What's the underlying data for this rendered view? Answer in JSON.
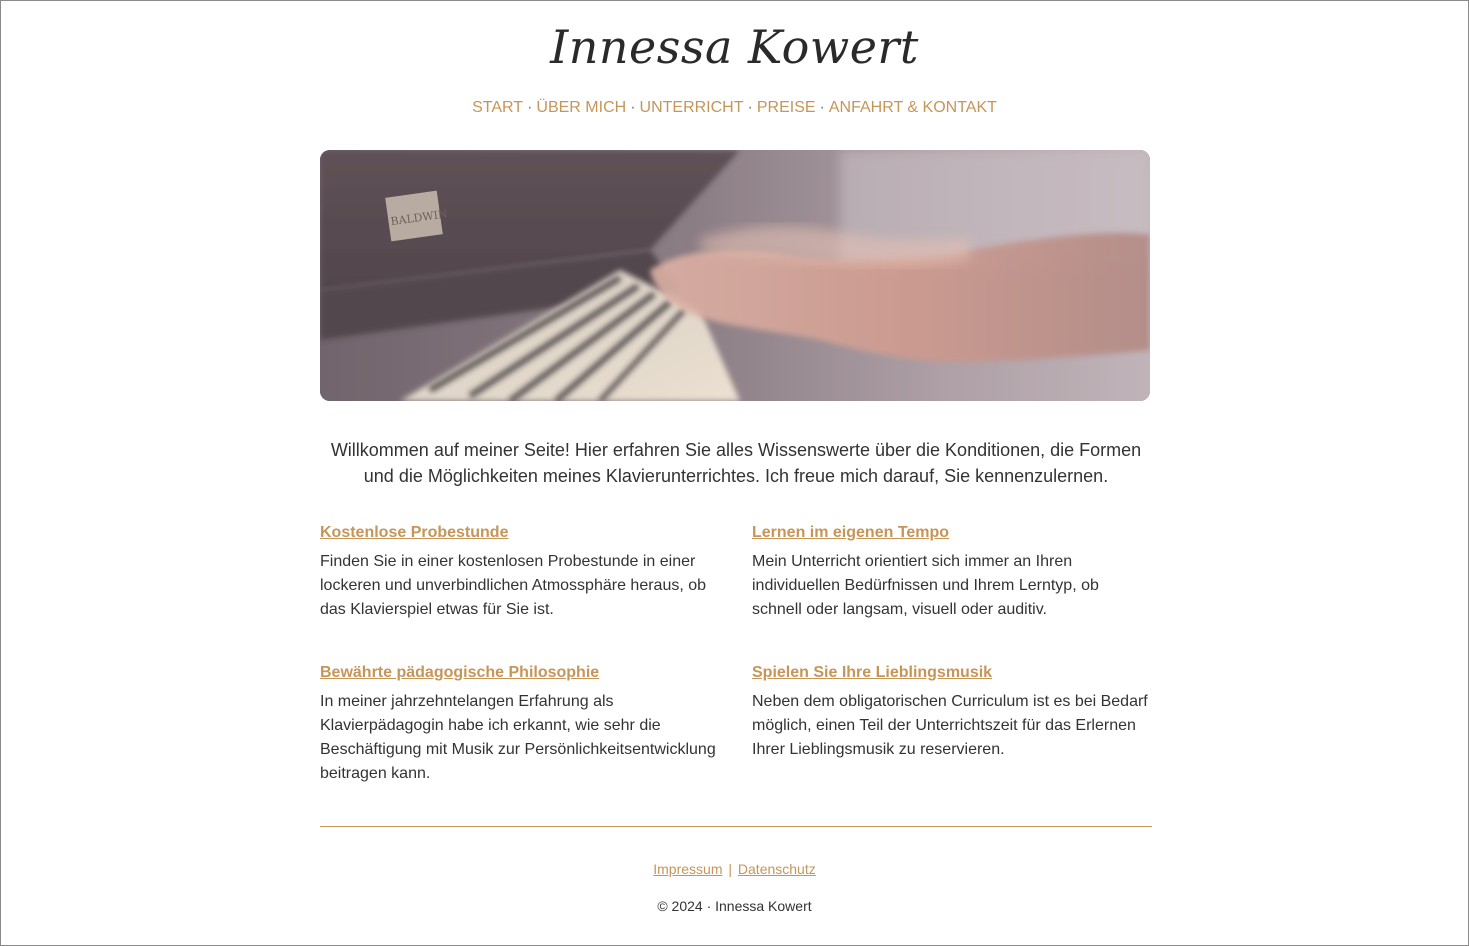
{
  "header": {
    "site_title": "Innessa Kowert"
  },
  "nav": {
    "items": [
      {
        "label": "START"
      },
      {
        "label": "ÜBER MICH"
      },
      {
        "label": "UNTERRICHT"
      },
      {
        "label": "PREISE"
      },
      {
        "label": "ANFAHRT & KONTAKT"
      }
    ],
    "separator": "·"
  },
  "hero": {
    "piano_brand": "BALDWIN"
  },
  "intro": {
    "text": "Willkommen auf meiner Seite! Hier erfahren Sie alles Wissenswerte über die Konditionen, die Formen und die Möglichkeiten meines Klavierunterrichtes. Ich freue mich darauf, Sie kennenzulernen."
  },
  "features": [
    {
      "title": "Kostenlose Probestunde",
      "text": "Finden Sie in einer kostenlosen Probestunde in einer lockeren und unverbindlichen Atmossphäre heraus, ob das Klavierspiel etwas für Sie ist."
    },
    {
      "title": "Lernen im eigenen Tempo",
      "text": "Mein Unterricht orientiert sich immer an Ihren individuellen Bedürfnissen und Ihrem Lerntyp, ob schnell oder langsam, visuell oder auditiv."
    },
    {
      "title": "Bewährte pädagogische Philosophie",
      "text": "In meiner jahrzehntelangen Erfahrung als Klavierpädagogin habe ich erkannt, wie sehr die Beschäftigung mit Musik zur Persönlichkeitsentwicklung beitragen kann."
    },
    {
      "title": "Spielen Sie Ihre Lieblingsmusik",
      "text": "Neben dem obligatorischen Curriculum ist es bei Bedarf möglich, einen Teil der Unterrichtszeit für das Erlernen Ihrer Lieblingsmusik zu reservieren."
    }
  ],
  "footer": {
    "impressum": "Impressum",
    "pipe": "|",
    "datenschutz": "Datenschutz",
    "copyright": "© 2024 · Innessa Kowert"
  },
  "colors": {
    "accent": "#c69558",
    "text": "#333333"
  }
}
